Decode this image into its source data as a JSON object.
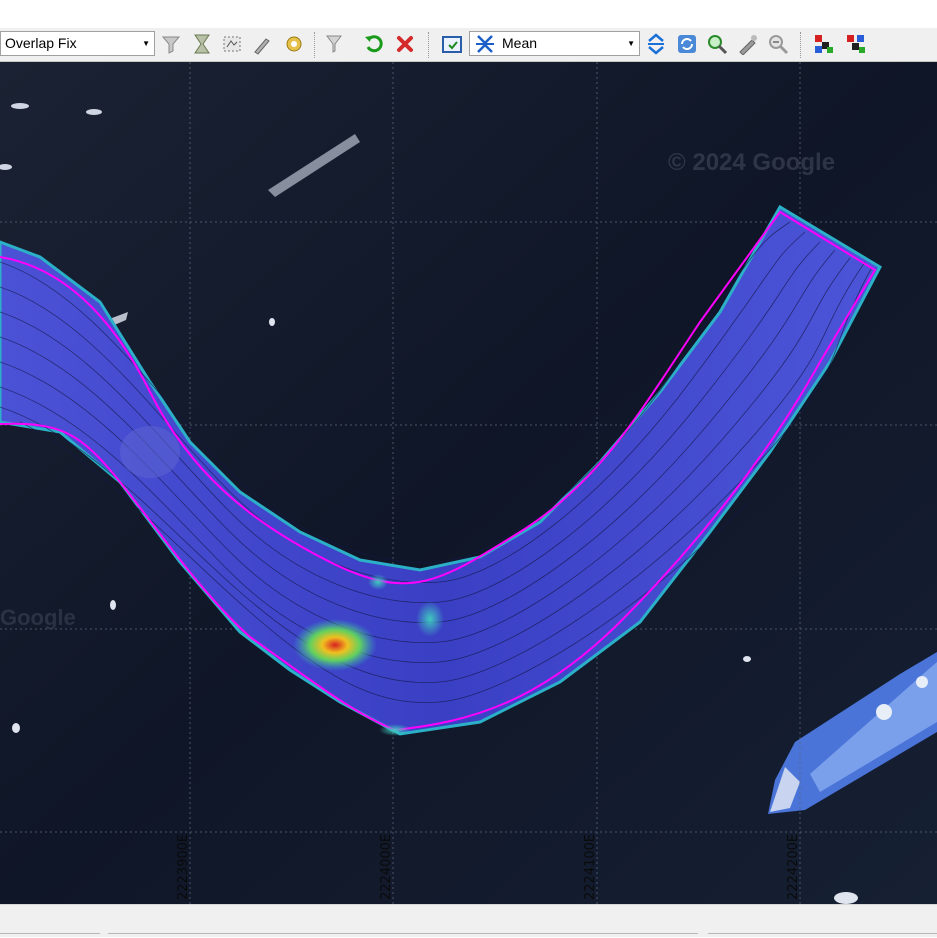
{
  "toolbar": {
    "filter_mode": "Overlap Fix",
    "surface_mode": "Mean"
  },
  "map": {
    "watermark": "© 2024 Google",
    "watermark2": "Google",
    "easting_labels": [
      "2223900E",
      "2224000E",
      "2224100E",
      "2224200E"
    ]
  },
  "colors": {
    "swath_boundary": "#ff00ff",
    "sea": "#0f1627",
    "swath_fill": "#3b42c8"
  }
}
